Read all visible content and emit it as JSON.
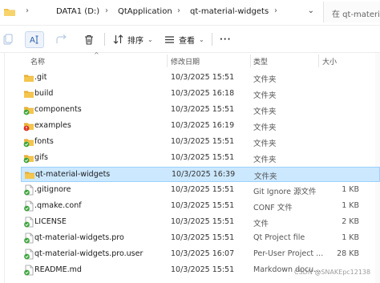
{
  "address": {
    "crumbs": [
      "DATA1 (D:)",
      "QtApplication",
      "qt-material-widgets"
    ],
    "search_placeholder": "在 qt-material-widgets 中搜索"
  },
  "toolbar": {
    "sort_label": "排序",
    "view_label": "查看"
  },
  "columns": {
    "name": "名称",
    "modified": "修改日期",
    "type": "类型",
    "size": "大小"
  },
  "rows": [
    {
      "name": ".git",
      "date": "10/3/2025 15:51",
      "type": "文件夹",
      "size": "",
      "icon": "folder-icon"
    },
    {
      "name": "build",
      "date": "10/3/2025 16:18",
      "type": "文件夹",
      "size": "",
      "icon": "folder-icon"
    },
    {
      "name": "components",
      "date": "10/3/2025 15:51",
      "type": "文件夹",
      "size": "",
      "icon": "folder-git-icon"
    },
    {
      "name": "examples",
      "date": "10/3/2025 16:19",
      "type": "文件夹",
      "size": "",
      "icon": "folder-git-error-icon"
    },
    {
      "name": "fonts",
      "date": "10/3/2025 15:51",
      "type": "文件夹",
      "size": "",
      "icon": "folder-git-icon"
    },
    {
      "name": "gifs",
      "date": "10/3/2025 15:51",
      "type": "文件夹",
      "size": "",
      "icon": "folder-git-icon"
    },
    {
      "name": "qt-material-widgets",
      "date": "10/3/2025 16:39",
      "type": "文件夹",
      "size": "",
      "icon": "folder-icon",
      "selected": true
    },
    {
      "name": ".gitignore",
      "date": "10/3/2025 15:51",
      "type": "Git Ignore 源文件",
      "size": "1 KB",
      "icon": "file-git-icon"
    },
    {
      "name": ".qmake.conf",
      "date": "10/3/2025 15:51",
      "type": "CONF 文件",
      "size": "1 KB",
      "icon": "file-git-icon"
    },
    {
      "name": "LICENSE",
      "date": "10/3/2025 15:51",
      "type": "文件",
      "size": "2 KB",
      "icon": "file-git-icon"
    },
    {
      "name": "qt-material-widgets.pro",
      "date": "10/3/2025 15:51",
      "type": "Qt Project file",
      "size": "1 KB",
      "icon": "file-git-icon"
    },
    {
      "name": "qt-material-widgets.pro.user",
      "date": "10/3/2025 16:07",
      "type": "Per-User Project ...",
      "size": "28 KB",
      "icon": "file-git-icon"
    },
    {
      "name": "README.md",
      "date": "10/3/2025 15:51",
      "type": "Markdown docu...",
      "size": "",
      "icon": "file-git-icon"
    }
  ],
  "watermark": "CSDN @SNAKEpc12138",
  "colors": {
    "folder": "#f2c14e",
    "git_green": "#3ea53e",
    "git_red": "#d93025",
    "selection": "#cce8ff",
    "selection_border": "#99d1ff"
  }
}
